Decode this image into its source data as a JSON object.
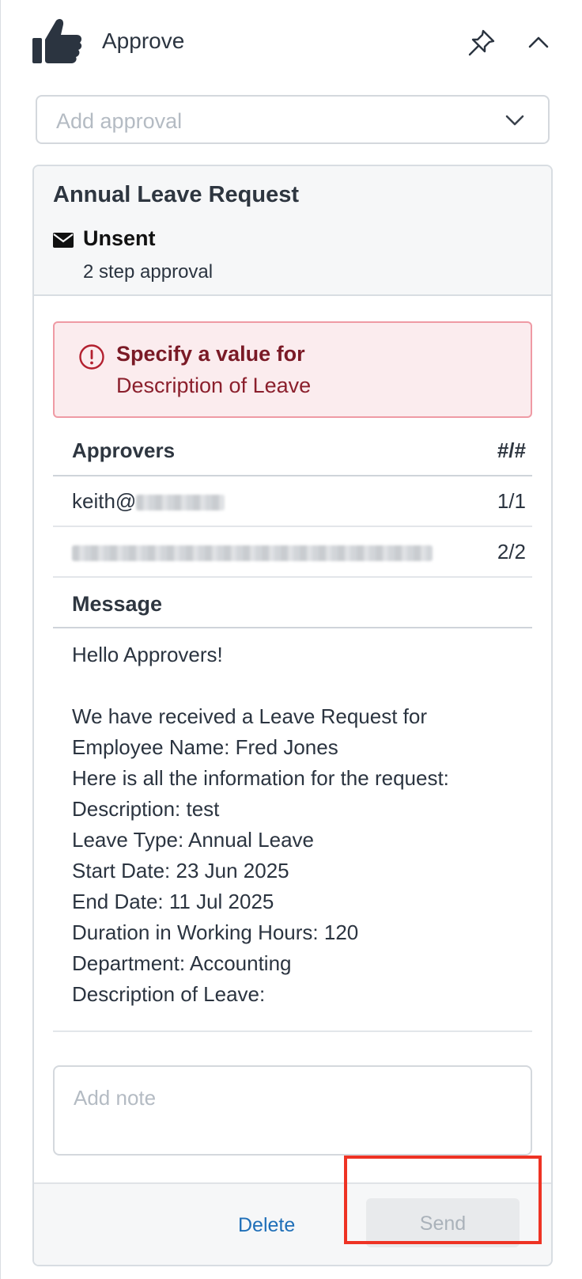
{
  "header": {
    "title": "Approve",
    "thumb_icon": "thumbs-up-icon",
    "pin_icon": "pin-icon",
    "collapse_icon": "chevron-up-icon"
  },
  "approval_select": {
    "placeholder": "Add approval"
  },
  "card": {
    "title": "Annual Leave Request",
    "status": "Unsent",
    "steps": "2 step approval",
    "alert": {
      "title": "Specify a value for",
      "field": "Description of Leave",
      "color": "#7a1a26"
    },
    "approvers": {
      "header_left": "Approvers",
      "header_right": "#/#",
      "rows": [
        {
          "email_prefix": "keith@",
          "step": "1/1"
        },
        {
          "email_prefix": "",
          "step": "2/2"
        }
      ]
    },
    "message": {
      "label": "Message",
      "lines": [
        "Hello Approvers!",
        "",
        "We have received a Leave Request for",
        "Employee Name: Fred Jones",
        "Here is all the information for the request:",
        "Description: test",
        "Leave Type: Annual Leave",
        "Start Date: 23 Jun 2025",
        "End Date: 11 Jul 2025",
        "Duration in Working Hours: 120",
        "Department: Accounting",
        "Description of Leave:"
      ]
    },
    "note_placeholder": "Add note",
    "actions": {
      "delete": "Delete",
      "send": "Send"
    }
  },
  "colors": {
    "accent_link": "#1f6fb8",
    "highlight": "#ee3324",
    "alert_bg": "#fbecee"
  }
}
